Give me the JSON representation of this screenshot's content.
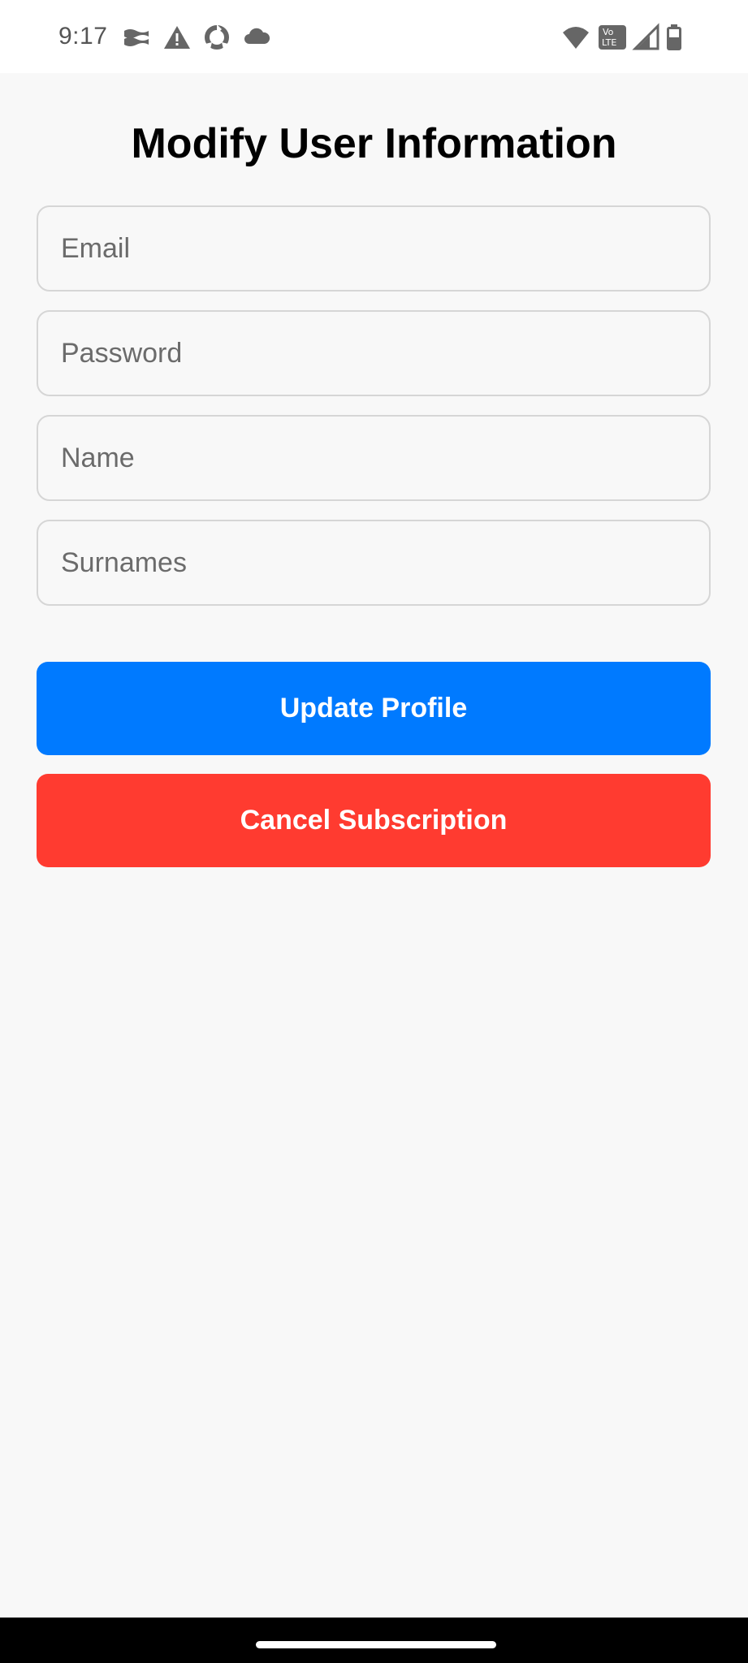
{
  "status_bar": {
    "time": "9:17",
    "left_icons": [
      "wave-flag-icon",
      "warning-icon",
      "sync-ring-icon",
      "cloud-icon"
    ],
    "right_icons": [
      "wifi-icon",
      "volte-icon",
      "cell-signal-icon",
      "battery-icon"
    ],
    "volte_top": "Vo",
    "volte_bottom": "LTE"
  },
  "form": {
    "title": "Modify User Information",
    "email_placeholder": "Email",
    "password_placeholder": "Password",
    "name_placeholder": "Name",
    "surnames_placeholder": "Surnames"
  },
  "actions": {
    "update_label": "Update Profile",
    "cancel_label": "Cancel Subscription"
  },
  "colors": {
    "primary": "#007aff",
    "danger": "#ff3b30",
    "background": "#f8f8f8",
    "border": "#d6d6d6"
  }
}
